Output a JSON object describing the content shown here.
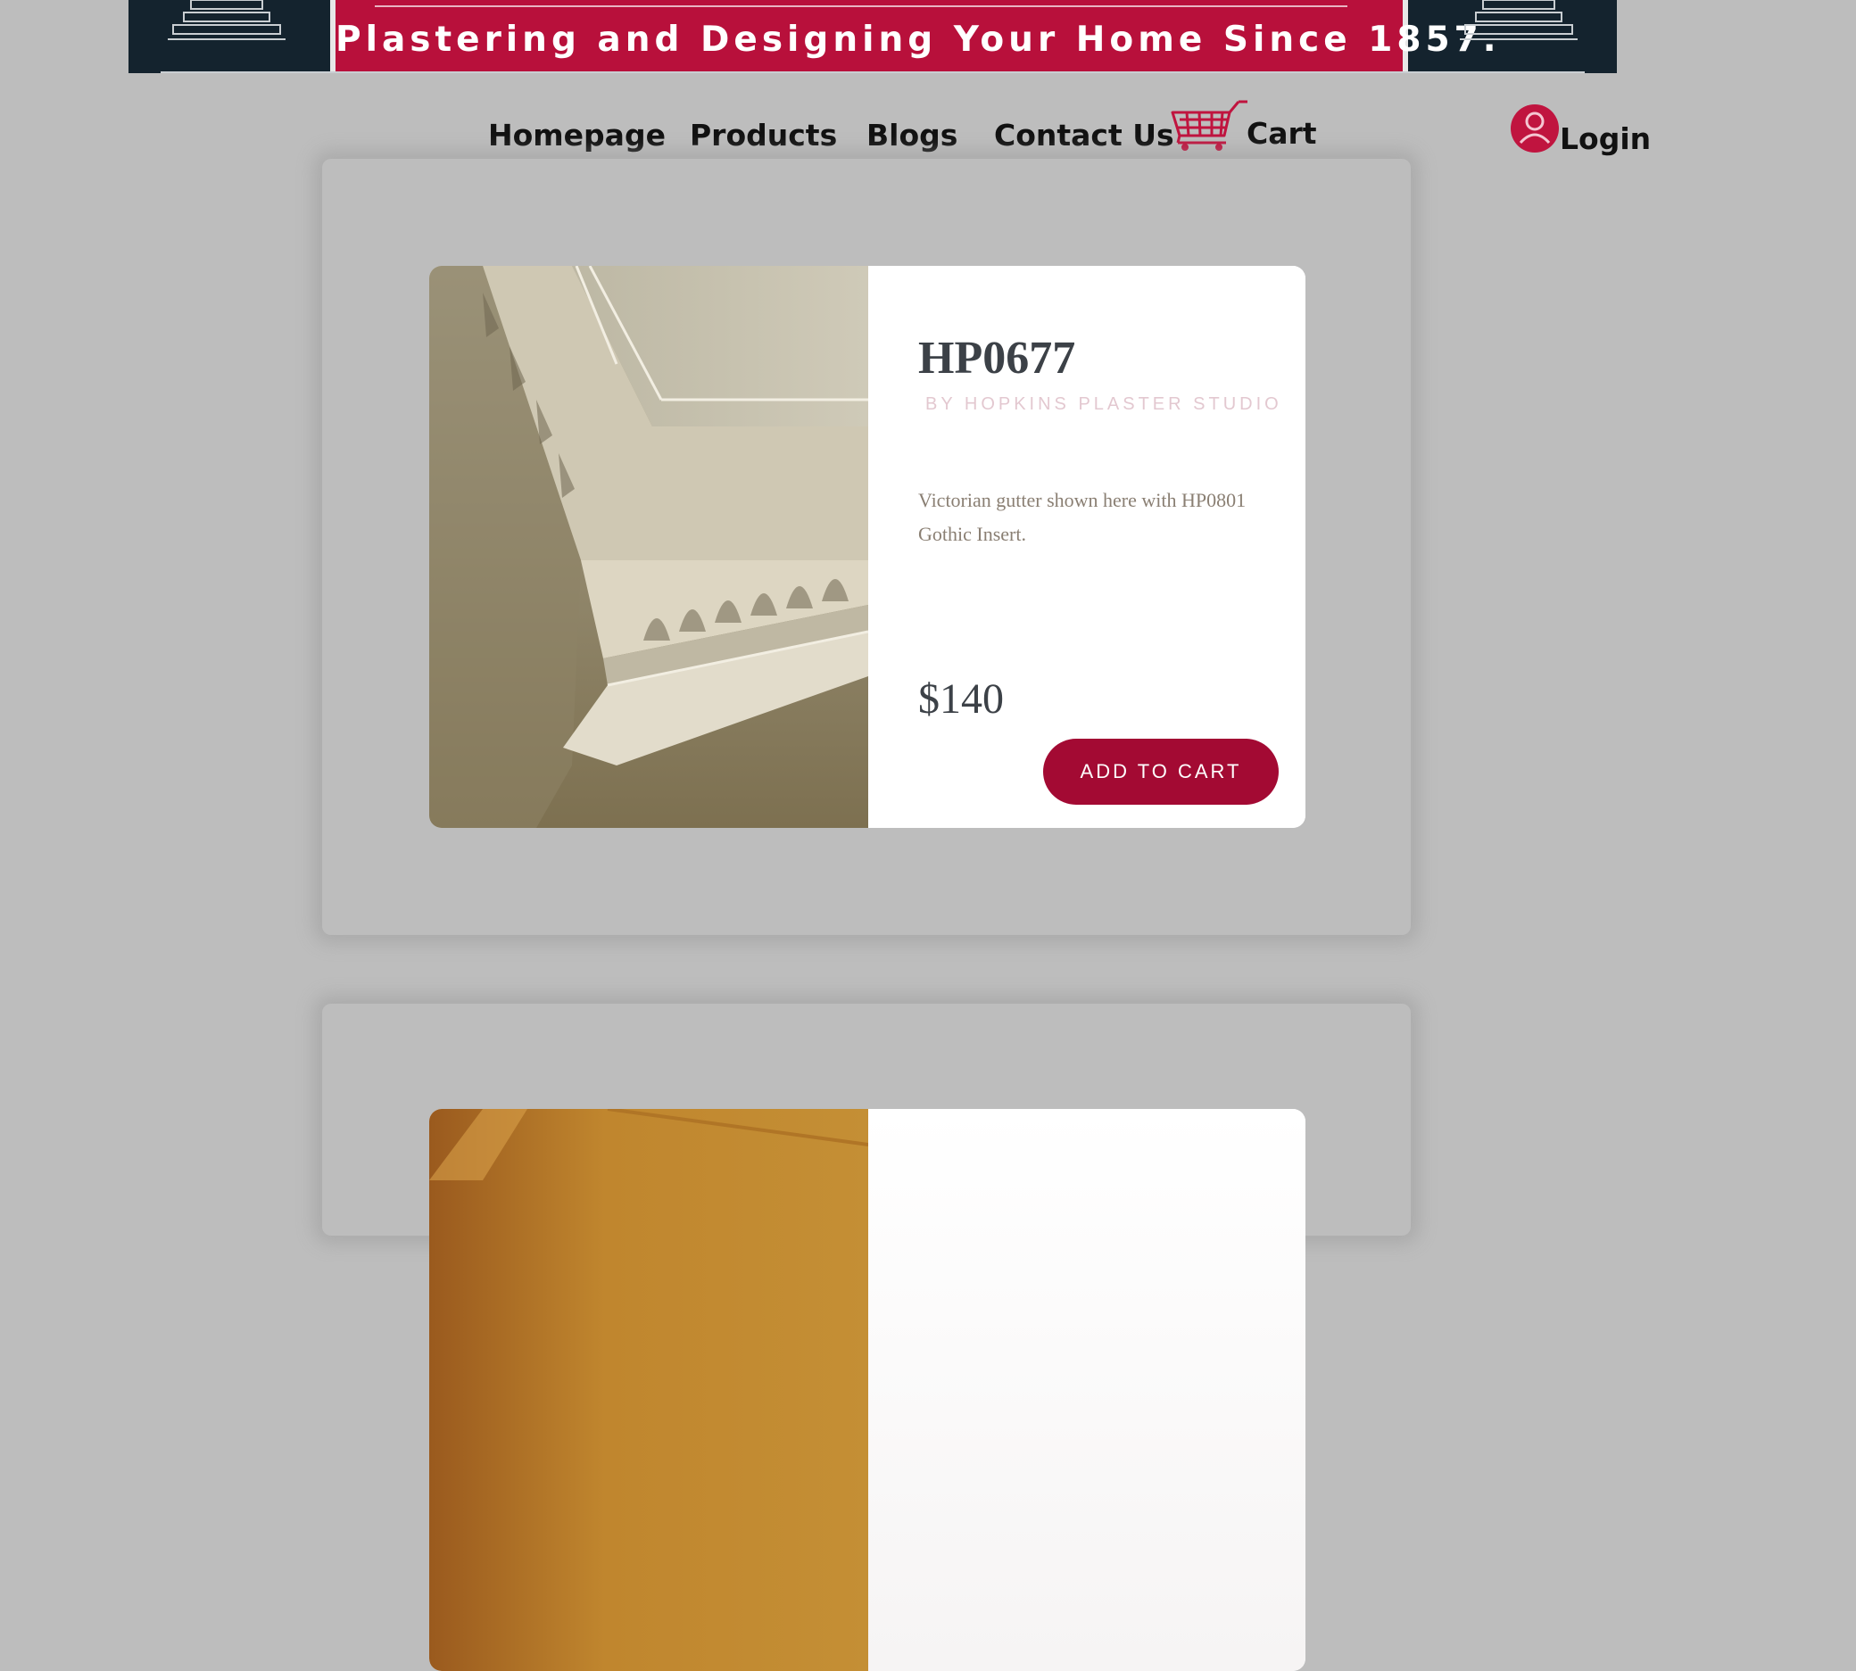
{
  "banner": {
    "tagline": "Plastering and Designing Your Home Since 1857."
  },
  "nav": {
    "items": [
      {
        "label": "Homepage"
      },
      {
        "label": "Products"
      },
      {
        "label": "Blogs"
      },
      {
        "label": "Contact Us"
      },
      {
        "label": "Cart"
      }
    ],
    "login_label": "Login"
  },
  "products": [
    {
      "code": "HP0677",
      "byline": "BY HOPKINS PLASTER STUDIO",
      "description": "Victorian gutter shown here with HP0801 Gothic Insert.",
      "price": "$140",
      "button_label": "ADD TO CART"
    }
  ],
  "colors": {
    "accent": "#a30a33",
    "banner_red": "#b8103b",
    "banner_navy": "#14232e",
    "background": "#bdbdbd"
  },
  "icons": [
    "pillar-icon",
    "cart-icon",
    "user-avatar-icon"
  ]
}
